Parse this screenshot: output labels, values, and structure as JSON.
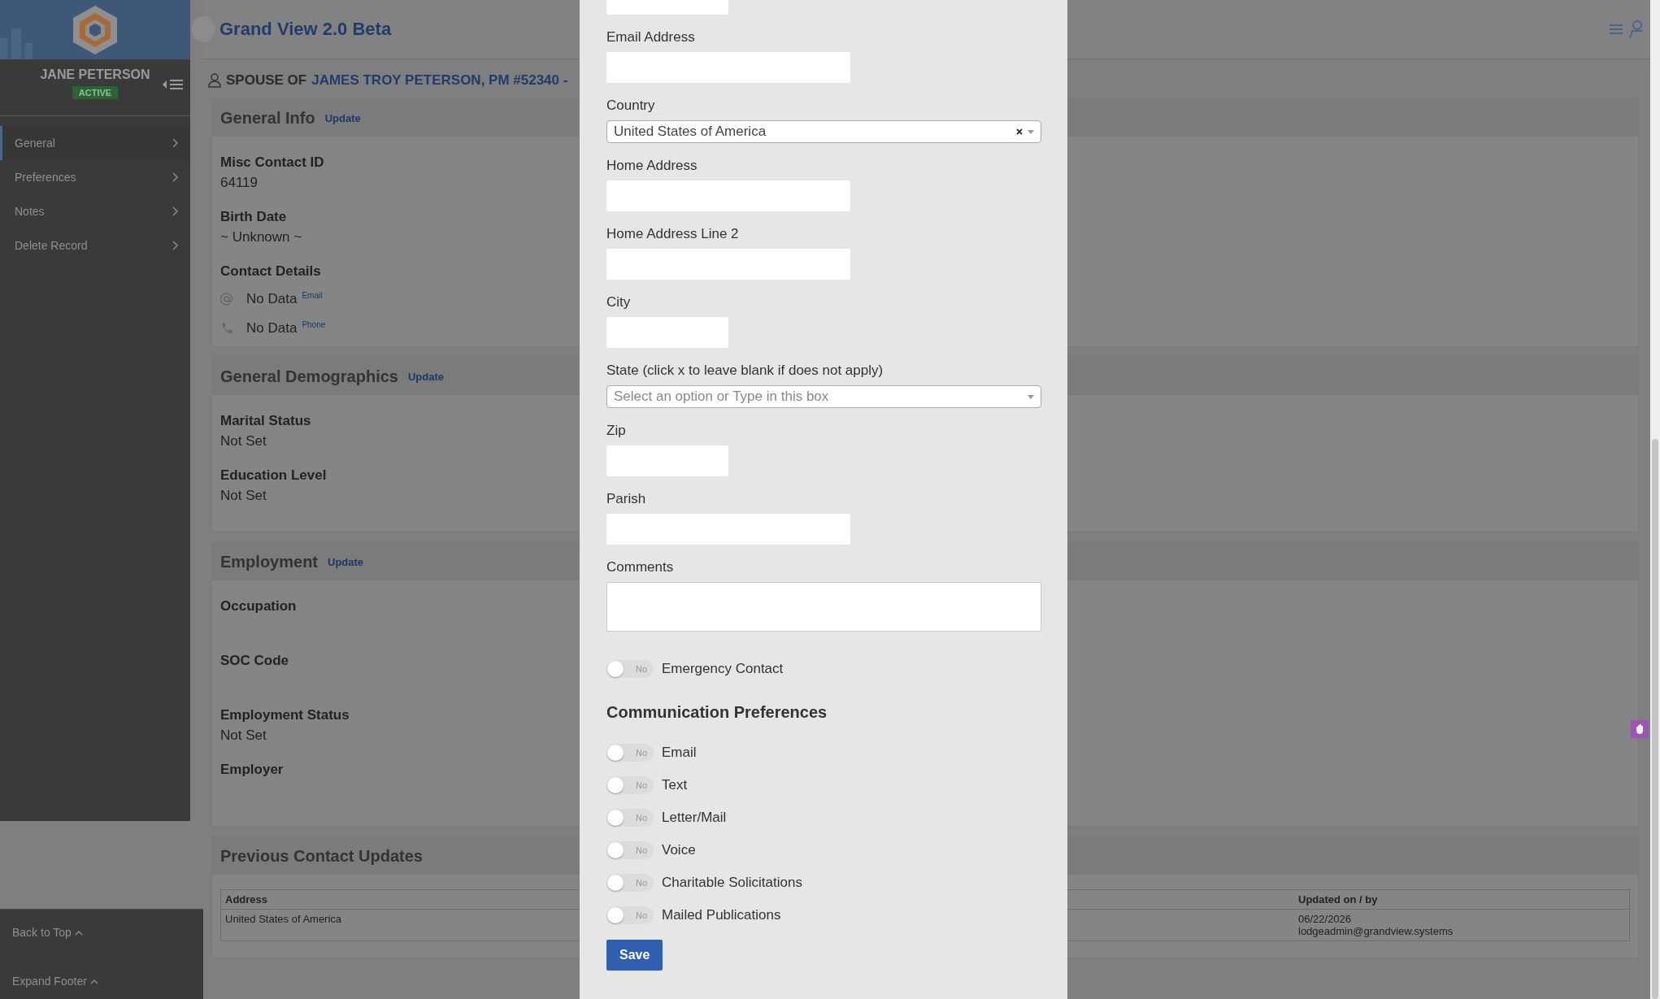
{
  "app": {
    "title": "Grand View 2.0 Beta"
  },
  "sidebar": {
    "name": "JANE PETERSON",
    "status": "ACTIVE",
    "items": [
      {
        "label": "General",
        "selected": true
      },
      {
        "label": "Preferences",
        "selected": false
      },
      {
        "label": "Notes",
        "selected": false
      },
      {
        "label": "Delete Record",
        "selected": false
      }
    ],
    "footer": [
      {
        "label": "Back to Top"
      },
      {
        "label": "Expand Footer"
      }
    ]
  },
  "record": {
    "relation": "SPOUSE OF",
    "link": "JAMES TROY PETERSON, PM #52340 -"
  },
  "sections": [
    {
      "title": "General Info",
      "action": "Update",
      "fields": [
        {
          "label": "Misc Contact ID",
          "value": "64119"
        },
        {
          "label": "Birth Date",
          "value": "~ Unknown ~"
        }
      ],
      "contacts_label": "Contact Details",
      "contacts": [
        {
          "kind": "email",
          "value": "No Data",
          "tag": "Email"
        },
        {
          "kind": "phone",
          "value": "No Data",
          "tag": "Phone"
        }
      ]
    },
    {
      "title": "General Demographics",
      "action": "Update",
      "fields": [
        {
          "label": "Marital Status",
          "value": "Not Set"
        },
        {
          "label": "Education Level",
          "value": "Not Set"
        }
      ]
    },
    {
      "title": "Employment",
      "action": "Update",
      "fields": [
        {
          "label": "Occupation"
        },
        {
          "label": "SOC Code"
        },
        {
          "label": "Employment Status",
          "value": "Not Set"
        },
        {
          "label": "Employer"
        }
      ]
    }
  ],
  "history": {
    "title": "Previous Contact Updates",
    "columns": [
      "Address",
      "Updated on / by"
    ],
    "rows": [
      {
        "address": "United States of America",
        "updated": [
          "06/22/2026",
          "lodgeadmin@grandview.systems"
        ]
      }
    ]
  },
  "modal": {
    "fields": [
      {
        "kind": "short"
      },
      {
        "kind": "text",
        "label": "Email Address"
      },
      {
        "kind": "select",
        "label": "Country",
        "value": "United States of America",
        "clearable": true
      },
      {
        "kind": "text",
        "label": "Home Address"
      },
      {
        "kind": "text",
        "label": "Home Address Line 2"
      },
      {
        "kind": "short",
        "label": "City"
      },
      {
        "kind": "select",
        "label": "State (click x to leave blank if does not apply)",
        "placeholder": "Select an option or Type in this box",
        "clearable": false
      },
      {
        "kind": "short",
        "label": "Zip"
      },
      {
        "kind": "text",
        "label": "Parish"
      },
      {
        "kind": "textarea",
        "label": "Comments"
      }
    ],
    "emergency": {
      "label": "Emergency Contact",
      "on": false,
      "text": "No"
    },
    "prefs_title": "Communication Preferences",
    "prefs": [
      {
        "label": "Email",
        "on": false,
        "text": "No"
      },
      {
        "label": "Text",
        "on": false,
        "text": "No"
      },
      {
        "label": "Letter/Mail",
        "on": false,
        "text": "No"
      },
      {
        "label": "Voice",
        "on": false,
        "text": "No"
      },
      {
        "label": "Charitable Solicitations",
        "on": false,
        "text": "No"
      },
      {
        "label": "Mailed Publications",
        "on": false,
        "text": "No"
      }
    ],
    "save": "Save"
  }
}
